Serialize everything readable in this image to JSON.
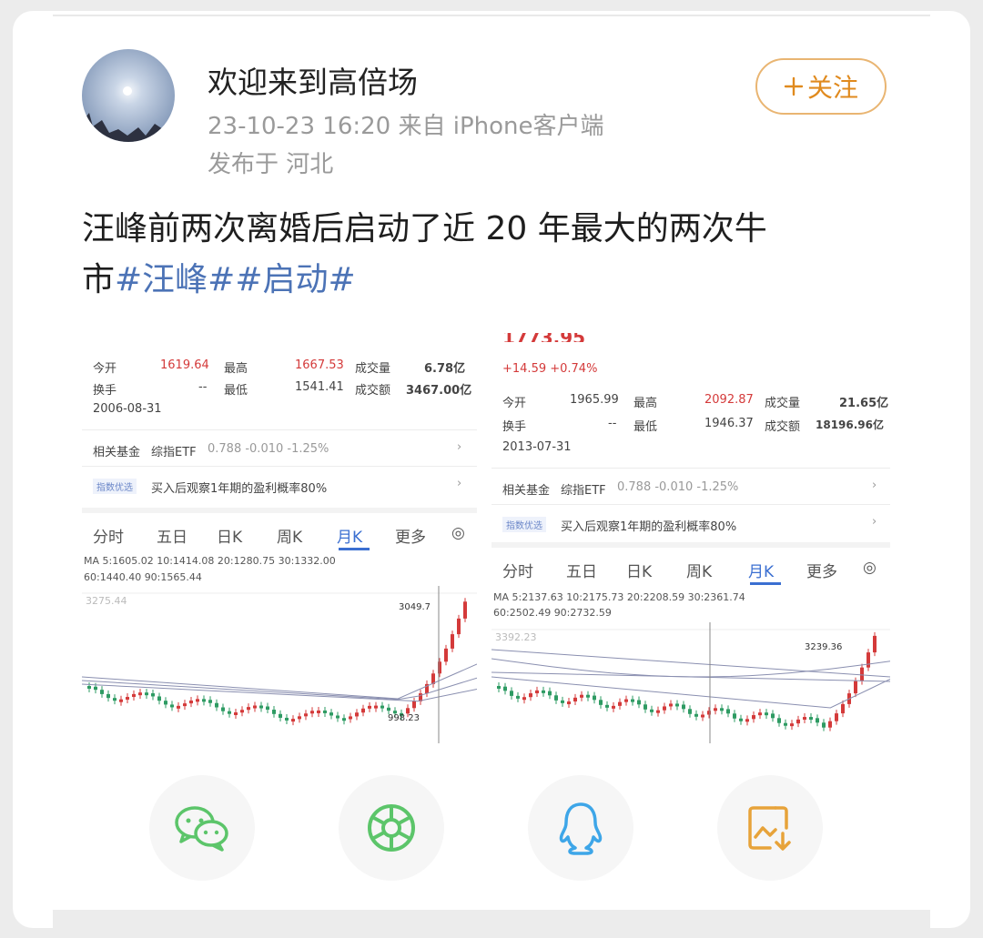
{
  "post": {
    "username": "欢迎来到高倍场",
    "time_source": "23-10-23 16:20  来自 iPhone客户端",
    "location": "发布于 河北",
    "follow_label": "关注",
    "text_line1": "汪峰前两次离婚后启动了近 20 年最大的两次牛",
    "text_line2_prefix": "市",
    "topic1": "#汪峰#",
    "topic2": "#启动#"
  },
  "screenshot1": {
    "r1": {
      "k1": "今开",
      "v1": "1619.64",
      "k2": "最高",
      "v2": "1667.53",
      "k3": "成交量",
      "v3": "6.78亿"
    },
    "r2": {
      "k1": "换手",
      "v1": "--",
      "k2": "最低",
      "v2": "1541.41",
      "k3": "成交额",
      "v3": "3467.00亿"
    },
    "date": "2006-08-31",
    "fund": {
      "label": "相关基金",
      "name": "综指ETF",
      "value": "0.788 -0.010 -1.25%"
    },
    "tip": {
      "badge": "指数优选",
      "text": "买入后观察1年期的盈利概率80%"
    },
    "tabs": [
      "分时",
      "五日",
      "日K",
      "周K",
      "月K",
      "更多"
    ],
    "ma1": "MA 5:1605.02 10:1414.08 20:1280.75 30:1332.00",
    "ma2": "60:1440.40 90:1565.44",
    "y_top": "3275.44",
    "peak": "3049.7",
    "low": "998.23"
  },
  "screenshot2": {
    "change": "+14.59  +0.74%",
    "r1": {
      "k1": "今开",
      "v1": "1965.99",
      "k2": "最高",
      "v2": "2092.87",
      "k3": "成交量",
      "v3": "21.65亿"
    },
    "r2": {
      "k1": "换手",
      "v1": "--",
      "k2": "最低",
      "v2": "1946.37",
      "k3": "成交额",
      "v3": "18196.96亿"
    },
    "date": "2013-07-31",
    "fund": {
      "label": "相关基金",
      "name": "综指ETF",
      "value": "0.788 -0.010 -1.25%"
    },
    "tip": {
      "badge": "指数优选",
      "text": "买入后观察1年期的盈利概率80%"
    },
    "tabs": [
      "分时",
      "五日",
      "日K",
      "周K",
      "月K",
      "更多"
    ],
    "ma1": "MA 5:2137.63 10:2175.73 20:2208.59 30:2361.74",
    "ma2": "60:2502.49 90:2732.59",
    "y_top": "3392.23",
    "peak": "3239.36"
  },
  "share": [
    {
      "name": "wechat",
      "color": "#5cc56a"
    },
    {
      "name": "moments",
      "color": "#5cc56a"
    },
    {
      "name": "qq",
      "color": "#3ea6e8"
    },
    {
      "name": "save-image",
      "color": "#e7a33a"
    }
  ],
  "colors": {
    "up": "#d43a3a",
    "down": "#2e9b63",
    "topic": "#4c73b6",
    "follow": "#e08a1e"
  }
}
